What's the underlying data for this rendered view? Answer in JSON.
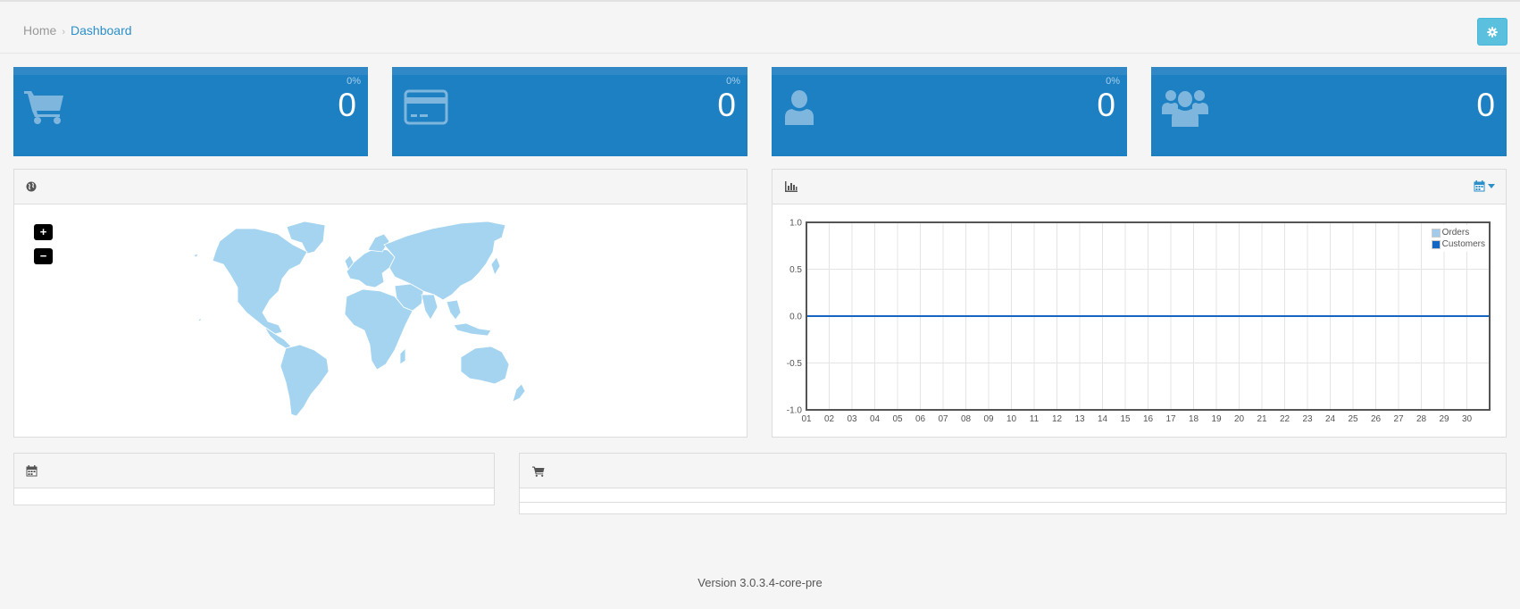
{
  "breadcrumb": {
    "home": "Home",
    "separator": "›",
    "current": "Dashboard"
  },
  "header": {
    "settings_icon": "gear-icon"
  },
  "stats": [
    {
      "icon": "shopping-cart-icon",
      "percent": "0%",
      "value": "0"
    },
    {
      "icon": "credit-card-icon",
      "percent": "0%",
      "value": "0"
    },
    {
      "icon": "user-icon",
      "percent": "0%",
      "value": "0"
    },
    {
      "icon": "users-icon",
      "percent": "",
      "value": "0"
    }
  ],
  "map_panel": {
    "icon": "globe-icon",
    "zoom_in": "+",
    "zoom_out": "−"
  },
  "chart_panel": {
    "icon": "bar-chart-icon",
    "range_icon": "calendar-icon"
  },
  "calendar_panel": {
    "icon": "calendar-icon"
  },
  "orders_panel": {
    "icon": "shopping-cart-icon"
  },
  "colors": {
    "accent": "#1d80c3",
    "map": "#a4d4f0",
    "orders": "#a4cbea",
    "customers": "#1466c2",
    "button": "#5bc0de"
  },
  "footer": {
    "version": "Version 3.0.3.4-core-pre"
  },
  "chart_data": {
    "type": "line",
    "title": "",
    "xlabel": "",
    "ylabel": "",
    "x": [
      "01",
      "02",
      "03",
      "04",
      "05",
      "06",
      "07",
      "08",
      "09",
      "10",
      "11",
      "12",
      "13",
      "14",
      "15",
      "16",
      "17",
      "18",
      "19",
      "20",
      "21",
      "22",
      "23",
      "24",
      "25",
      "26",
      "27",
      "28",
      "29",
      "30"
    ],
    "ylim": [
      -1.0,
      1.0
    ],
    "yticks": [
      "1.0",
      "0.5",
      "0.0",
      "-0.5",
      "-1.0"
    ],
    "grid": true,
    "legend_position": "top-right",
    "series": [
      {
        "name": "Orders",
        "color": "#a4cbea",
        "values": [
          0,
          0,
          0,
          0,
          0,
          0,
          0,
          0,
          0,
          0,
          0,
          0,
          0,
          0,
          0,
          0,
          0,
          0,
          0,
          0,
          0,
          0,
          0,
          0,
          0,
          0,
          0,
          0,
          0,
          0
        ]
      },
      {
        "name": "Customers",
        "color": "#1466c2",
        "values": [
          0,
          0,
          0,
          0,
          0,
          0,
          0,
          0,
          0,
          0,
          0,
          0,
          0,
          0,
          0,
          0,
          0,
          0,
          0,
          0,
          0,
          0,
          0,
          0,
          0,
          0,
          0,
          0,
          0,
          0
        ]
      }
    ]
  }
}
